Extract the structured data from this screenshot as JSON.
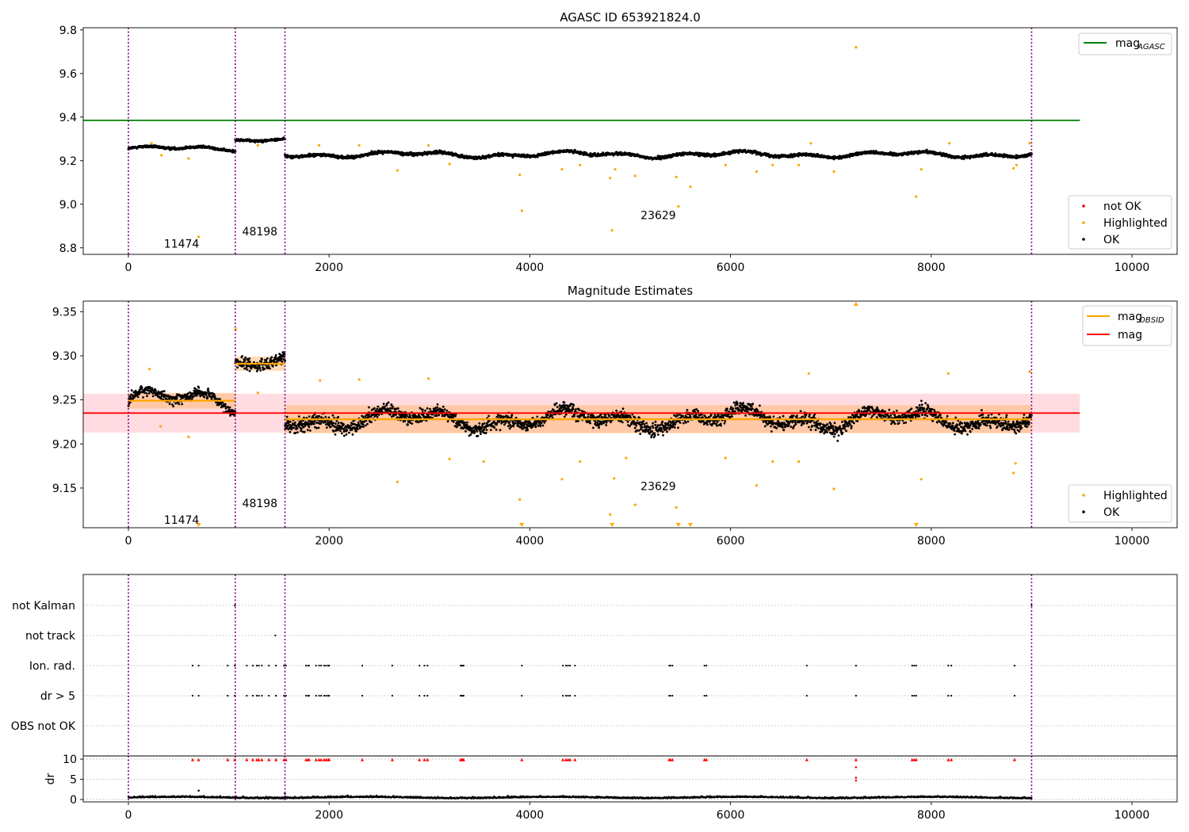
{
  "chart_data": [
    {
      "type": "scatter",
      "title": "AGASC ID 653921824.0",
      "xlim": [
        -450,
        10450
      ],
      "ylim": [
        8.77,
        9.81
      ],
      "xticks": [
        0,
        2000,
        4000,
        6000,
        8000,
        10000
      ],
      "yticks": [
        8.8,
        9.0,
        9.2,
        9.4,
        9.6,
        9.8
      ],
      "ytick_labels": [
        "8.8",
        "9.0",
        "9.2",
        "9.4",
        "9.6",
        "9.8"
      ],
      "grid": false,
      "legend_line": {
        "position": "top-right",
        "entries": [
          {
            "label": "mag",
            "sub": "AGASC",
            "color": "#008000"
          }
        ]
      },
      "legend_points": {
        "position": "bottom-right",
        "entries": [
          {
            "label": "not OK",
            "color": "#ff0000"
          },
          {
            "label": "Highlighted",
            "color": "#ffa500"
          },
          {
            "label": "OK",
            "color": "#000000"
          }
        ]
      },
      "reference_line": {
        "name": "mag_AGASC",
        "y": 9.385,
        "x": [
          -450,
          9480
        ],
        "color": "#008000"
      },
      "obsid_boundaries": [
        0,
        1065,
        1560,
        9000
      ],
      "obsid_labels": [
        {
          "text": "11474",
          "x": 530,
          "y": 8.82
        },
        {
          "text": "48198",
          "x": 1310,
          "y": 8.875
        },
        {
          "text": "23629",
          "x": 5280,
          "y": 8.95
        }
      ],
      "segments": [
        {
          "x": [
            0,
            1065
          ],
          "level": 9.255,
          "amp": 0.012,
          "noise": 0.009
        },
        {
          "x": [
            1065,
            1560
          ],
          "level": 9.293,
          "amp": 0.008,
          "noise": 0.009
        },
        {
          "x": [
            1560,
            9000
          ],
          "level": 9.228,
          "amp": 0.015,
          "noise": 0.011
        }
      ],
      "highlighted_points": [
        {
          "x": 230,
          "y": 9.28
        },
        {
          "x": 330,
          "y": 9.225
        },
        {
          "x": 600,
          "y": 9.21
        },
        {
          "x": 700,
          "y": 8.85
        },
        {
          "x": 1290,
          "y": 9.27
        },
        {
          "x": 1900,
          "y": 9.27
        },
        {
          "x": 2300,
          "y": 9.27
        },
        {
          "x": 2680,
          "y": 9.155
        },
        {
          "x": 2990,
          "y": 9.27
        },
        {
          "x": 3200,
          "y": 9.185
        },
        {
          "x": 3900,
          "y": 9.135
        },
        {
          "x": 3920,
          "y": 8.97
        },
        {
          "x": 4320,
          "y": 9.16
        },
        {
          "x": 4500,
          "y": 9.18
        },
        {
          "x": 4800,
          "y": 9.12
        },
        {
          "x": 4820,
          "y": 8.88
        },
        {
          "x": 4850,
          "y": 9.16
        },
        {
          "x": 5050,
          "y": 9.13
        },
        {
          "x": 5460,
          "y": 9.125
        },
        {
          "x": 5480,
          "y": 8.99
        },
        {
          "x": 5600,
          "y": 9.08
        },
        {
          "x": 5950,
          "y": 9.18
        },
        {
          "x": 6260,
          "y": 9.15
        },
        {
          "x": 6420,
          "y": 9.18
        },
        {
          "x": 6680,
          "y": 9.18
        },
        {
          "x": 6800,
          "y": 9.28
        },
        {
          "x": 7030,
          "y": 9.15
        },
        {
          "x": 7250,
          "y": 9.72
        },
        {
          "x": 7850,
          "y": 9.035
        },
        {
          "x": 7900,
          "y": 9.16
        },
        {
          "x": 8180,
          "y": 9.28
        },
        {
          "x": 8820,
          "y": 9.165
        },
        {
          "x": 8850,
          "y": 9.18
        },
        {
          "x": 8980,
          "y": 9.28
        }
      ]
    },
    {
      "type": "scatter",
      "title": "Magnitude Estimates",
      "xlim": [
        -450,
        10450
      ],
      "ylim": [
        9.105,
        9.362
      ],
      "xticks": [
        0,
        2000,
        4000,
        6000,
        8000,
        10000
      ],
      "yticks": [
        9.15,
        9.2,
        9.25,
        9.3,
        9.35
      ],
      "ytick_labels": [
        "9.15",
        "9.20",
        "9.25",
        "9.30",
        "9.35"
      ],
      "grid": false,
      "legend_line": {
        "position": "top-right",
        "entries": [
          {
            "label": "mag",
            "sub": "OBSID",
            "color": "#ffa500"
          },
          {
            "label": "mag",
            "sub": "",
            "color": "#ff0000"
          }
        ]
      },
      "legend_points": {
        "position": "bottom-right",
        "entries": [
          {
            "label": "Highlighted",
            "color": "#ffa500"
          },
          {
            "label": "OK",
            "color": "#000000"
          }
        ]
      },
      "mag_line": {
        "y": 9.235,
        "x": [
          -450,
          9480
        ],
        "band": [
          9.213,
          9.257
        ],
        "color": "#ff0000"
      },
      "obsid_levels": [
        {
          "x": [
            0,
            1065
          ],
          "y": 9.249,
          "band": [
            9.24,
            9.258
          ]
        },
        {
          "x": [
            1065,
            1560
          ],
          "y": 9.291,
          "band": [
            9.283,
            9.299
          ]
        },
        {
          "x": [
            1560,
            9000
          ],
          "y": 9.228,
          "band": [
            9.212,
            9.244
          ]
        }
      ],
      "obsid_boundaries": [
        0,
        1065,
        1560,
        9000
      ],
      "obsid_labels": [
        {
          "text": "11474",
          "x": 530,
          "y": 9.114
        },
        {
          "text": "48198",
          "x": 1310,
          "y": 9.133
        },
        {
          "text": "23629",
          "x": 5280,
          "y": 9.152
        }
      ],
      "segments": [
        {
          "x": [
            0,
            1065
          ],
          "level": 9.249,
          "amp": 0.014,
          "noise": 0.01
        },
        {
          "x": [
            1065,
            1560
          ],
          "level": 9.291,
          "amp": 0.01,
          "noise": 0.011
        },
        {
          "x": [
            1560,
            9000
          ],
          "level": 9.228,
          "amp": 0.012,
          "noise": 0.013
        }
      ],
      "highlighted_points": [
        {
          "x": 210,
          "y": 9.285
        },
        {
          "x": 320,
          "y": 9.22
        },
        {
          "x": 600,
          "y": 9.208
        },
        {
          "x": 1070,
          "y": 9.33
        },
        {
          "x": 1290,
          "y": 9.258
        },
        {
          "x": 1910,
          "y": 9.272
        },
        {
          "x": 2300,
          "y": 9.273
        },
        {
          "x": 2680,
          "y": 9.157
        },
        {
          "x": 2990,
          "y": 9.274
        },
        {
          "x": 3200,
          "y": 9.183
        },
        {
          "x": 3540,
          "y": 9.18
        },
        {
          "x": 3900,
          "y": 9.137
        },
        {
          "x": 4320,
          "y": 9.16
        },
        {
          "x": 4500,
          "y": 9.18
        },
        {
          "x": 4800,
          "y": 9.12
        },
        {
          "x": 4840,
          "y": 9.161
        },
        {
          "x": 4960,
          "y": 9.184
        },
        {
          "x": 5050,
          "y": 9.131
        },
        {
          "x": 5460,
          "y": 9.128
        },
        {
          "x": 5950,
          "y": 9.184
        },
        {
          "x": 6260,
          "y": 9.153
        },
        {
          "x": 6420,
          "y": 9.18
        },
        {
          "x": 6680,
          "y": 9.18
        },
        {
          "x": 6780,
          "y": 9.28
        },
        {
          "x": 7030,
          "y": 9.149
        },
        {
          "x": 7900,
          "y": 9.16
        },
        {
          "x": 8170,
          "y": 9.28
        },
        {
          "x": 8820,
          "y": 9.167
        },
        {
          "x": 8840,
          "y": 9.178
        },
        {
          "x": 8980,
          "y": 9.282
        }
      ],
      "clipped_low": [
        700,
        3920,
        4820,
        5480,
        5600,
        7850
      ],
      "clipped_high": [
        7250
      ]
    },
    {
      "type": "scatter",
      "title": "",
      "xlim": [
        -450,
        10450
      ],
      "xticks": [
        0,
        2000,
        4000,
        6000,
        8000,
        10000
      ],
      "grid": false,
      "flag_rows": [
        "not Kalman",
        "not track",
        "Ion. rad.",
        "dr > 5",
        "OBS not OK"
      ],
      "obsid_boundaries": [
        0,
        1065,
        1560,
        9000
      ],
      "flag_x": {
        "not Kalman": [
          1060,
          9000
        ],
        "not track": [
          1465
        ],
        "Ion. rad.": [
          640,
          700,
          990,
          1060,
          1180,
          1240,
          1280,
          1300,
          1330,
          1400,
          1470,
          1550,
          1570,
          1770,
          1790,
          1800,
          1870,
          1900,
          1920,
          1950,
          1970,
          1990,
          2000,
          2330,
          2630,
          2900,
          2950,
          2980,
          3310,
          3320,
          3330,
          3340,
          3920,
          4330,
          4360,
          4380,
          4400,
          4450,
          5390,
          5400,
          5420,
          5740,
          5760,
          6760,
          7250,
          7810,
          7830,
          7850,
          8170,
          8200,
          8830
        ],
        "dr > 5": [
          640,
          700,
          990,
          1060,
          1180,
          1240,
          1280,
          1300,
          1330,
          1400,
          1470,
          1550,
          1570,
          1770,
          1790,
          1800,
          1870,
          1900,
          1920,
          1950,
          1970,
          1990,
          2000,
          2330,
          2630,
          2900,
          2950,
          2980,
          3310,
          3320,
          3330,
          3340,
          3920,
          4330,
          4360,
          4380,
          4400,
          4450,
          5390,
          5400,
          5420,
          5740,
          5760,
          6760,
          7250,
          7810,
          7830,
          7850,
          8170,
          8200,
          8830
        ],
        "OBS not OK": []
      },
      "dr_panel": {
        "ylabel": "dr",
        "ylim": [
          -0.6,
          10.8
        ],
        "yticks": [
          0,
          5,
          10
        ],
        "ytick_labels": [
          "0",
          "5",
          "10"
        ],
        "capped_y": 9.9,
        "extra_points": [
          {
            "x": 700,
            "y": 2.2
          },
          {
            "x": 7250,
            "y": 4.7
          },
          {
            "x": 7250,
            "y": 5.4
          },
          {
            "x": 7250,
            "y": 8.0
          },
          {
            "x": 1560,
            "y": 1.5
          }
        ]
      }
    }
  ]
}
